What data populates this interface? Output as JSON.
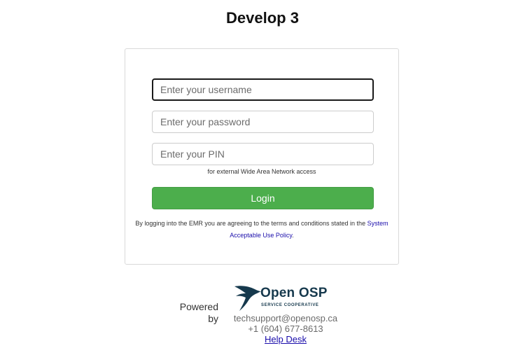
{
  "page": {
    "title": "Develop 3"
  },
  "form": {
    "username_placeholder": "Enter your username",
    "password_placeholder": "Enter your password",
    "pin_placeholder": "Enter your PIN",
    "pin_note": "for external Wide Area Network access",
    "login_label": "Login",
    "terms_prefix": "By logging into the EMR you are agreeing to the terms and conditions stated in the",
    "terms_link": "System Acceptable Use Policy",
    "terms_suffix": "."
  },
  "footer": {
    "powered_line1": "Powered",
    "powered_line2": "by",
    "logo_name": "Open OSP",
    "logo_subtitle": "SERVICE COOPERATIVE",
    "email": "techsupport@openosp.ca",
    "phone": "+1 (604) 677-8613",
    "help_link": "Help Desk"
  },
  "colors": {
    "login_button": "#4cae4c",
    "link": "#1a0dab",
    "logo": "#16394d"
  }
}
